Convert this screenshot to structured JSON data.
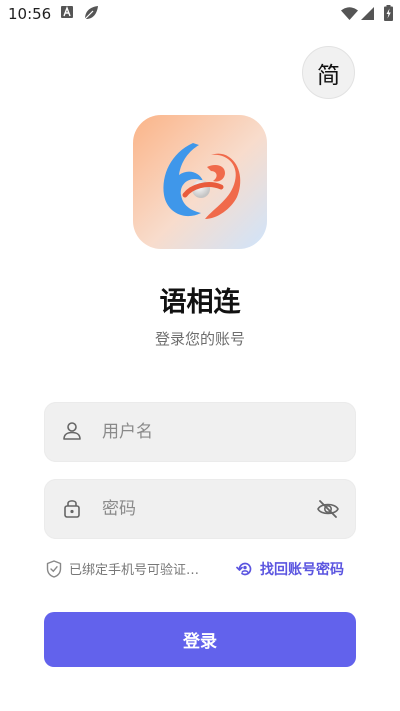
{
  "status_bar": {
    "time": "10:56",
    "icons": [
      "notification-a-icon",
      "leaf-icon",
      "wifi-icon",
      "signal-icon",
      "battery-charging-icon"
    ]
  },
  "language_button": {
    "label": "简"
  },
  "app": {
    "name": "语相连",
    "subtitle": "登录您的账号"
  },
  "form": {
    "username": {
      "placeholder": "用户名",
      "value": "",
      "icon": "user-icon"
    },
    "password": {
      "placeholder": "密码",
      "value": "",
      "icon": "lock-icon",
      "toggle_icon": "eye-off-icon"
    }
  },
  "consent": {
    "text": "已绑定手机号可验证…",
    "icon": "shield-check-icon"
  },
  "forgot": {
    "label": "找回账号密码",
    "icon": "account-recovery-icon"
  },
  "login_button": {
    "label": "登录"
  },
  "colors": {
    "accent": "#6262ec",
    "link": "#5b55e0",
    "logo_gradient_start": "#fbb488",
    "logo_gradient_end": "#cfe4fb",
    "logo_blue": "#3f97ea",
    "logo_orange": "#f06a4b"
  }
}
